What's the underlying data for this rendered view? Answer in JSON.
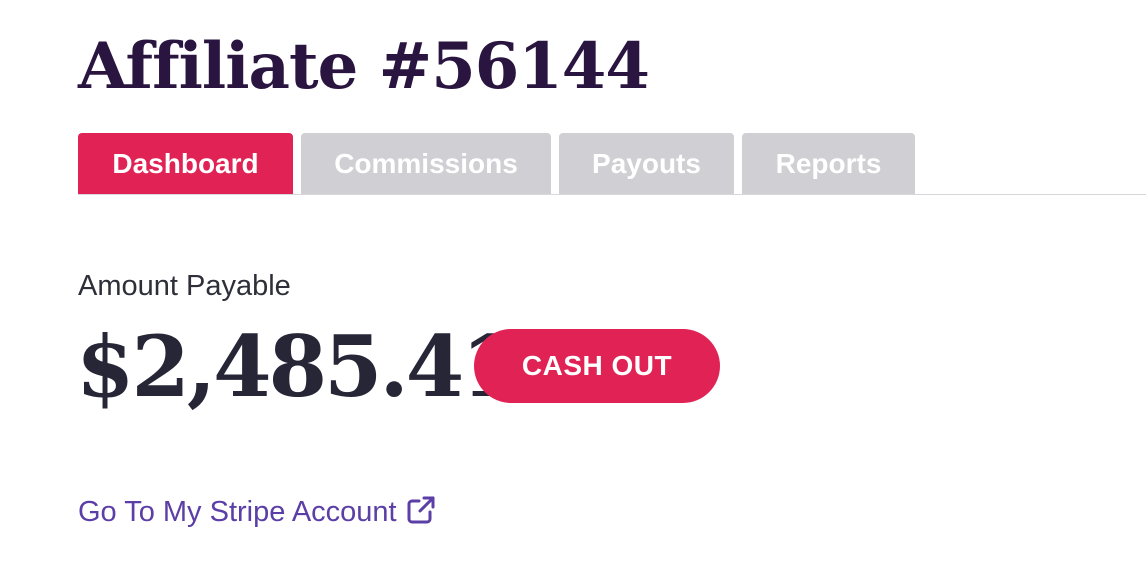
{
  "header": {
    "title": "Affiliate #56144"
  },
  "tabs": [
    {
      "label": "Dashboard",
      "active": true
    },
    {
      "label": "Commissions",
      "active": false
    },
    {
      "label": "Payouts",
      "active": false
    },
    {
      "label": "Reports",
      "active": false
    }
  ],
  "balance": {
    "label": "Amount Payable",
    "amount": "$2,485.41",
    "cash_out_label": "CASH OUT"
  },
  "stripe": {
    "link_label": "Go To My Stripe Account",
    "icon": "external-link-icon"
  },
  "colors": {
    "title": "#2a1540",
    "accent": "#e02354",
    "inactive_tab": "#cfcfd4",
    "link": "#5b3ea6",
    "amount": "#262637"
  }
}
